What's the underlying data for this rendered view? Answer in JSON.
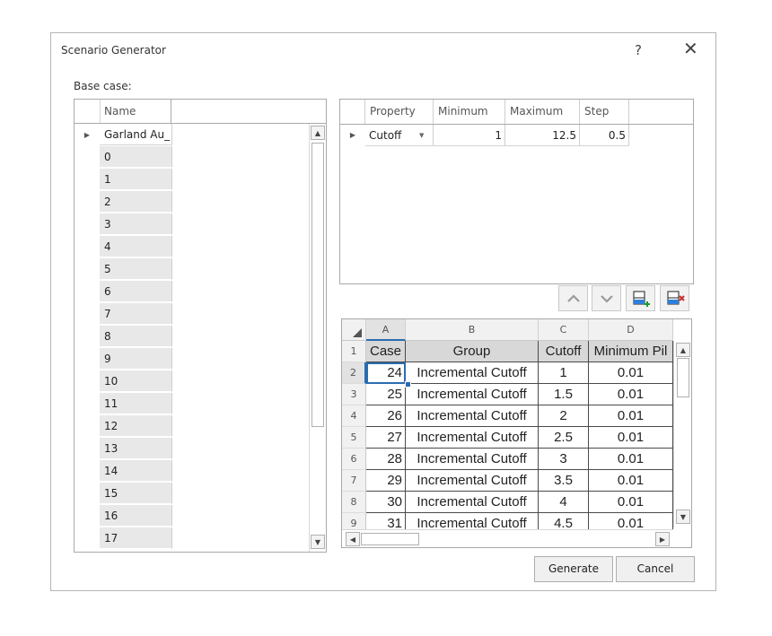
{
  "dialog": {
    "title": "Scenario Generator",
    "help_label": "?",
    "close_label": "✕"
  },
  "base_case": {
    "label": "Base case:",
    "column_header": "Name",
    "rows": [
      "Garland Au_",
      "0",
      "1",
      "2",
      "3",
      "4",
      "5",
      "6",
      "7",
      "8",
      "9",
      "10",
      "11",
      "12",
      "13",
      "14",
      "15",
      "16",
      "17"
    ]
  },
  "property_grid": {
    "headers": [
      "Property",
      "Minimum",
      "Maximum",
      "Step"
    ],
    "row": {
      "property": "Cutoff",
      "minimum": "1",
      "maximum": "12.5",
      "step": "0.5"
    }
  },
  "toolbar": {
    "move_up_icon": "chevron-up-icon",
    "move_down_icon": "chevron-down-icon",
    "add_row_icon": "add-row-icon",
    "delete_row_icon": "delete-row-icon"
  },
  "sheet": {
    "column_letters": [
      "A",
      "B",
      "C",
      "D"
    ],
    "row_numbers": [
      "1",
      "2",
      "3",
      "4",
      "5",
      "6",
      "7",
      "8",
      "9"
    ],
    "header_cells": [
      "Case",
      "Group",
      "Cutoff",
      "Minimum Pil"
    ],
    "rows": [
      [
        "24",
        "Incremental Cutoff",
        "1",
        "0.01"
      ],
      [
        "25",
        "Incremental Cutoff",
        "1.5",
        "0.01"
      ],
      [
        "26",
        "Incremental Cutoff",
        "2",
        "0.01"
      ],
      [
        "27",
        "Incremental Cutoff",
        "2.5",
        "0.01"
      ],
      [
        "28",
        "Incremental Cutoff",
        "3",
        "0.01"
      ],
      [
        "29",
        "Incremental Cutoff",
        "3.5",
        "0.01"
      ],
      [
        "30",
        "Incremental Cutoff",
        "4",
        "0.01"
      ],
      [
        "31",
        "Incremental Cutoff",
        "4.5",
        "0.01"
      ]
    ]
  },
  "buttons": {
    "generate": "Generate",
    "cancel": "Cancel"
  }
}
